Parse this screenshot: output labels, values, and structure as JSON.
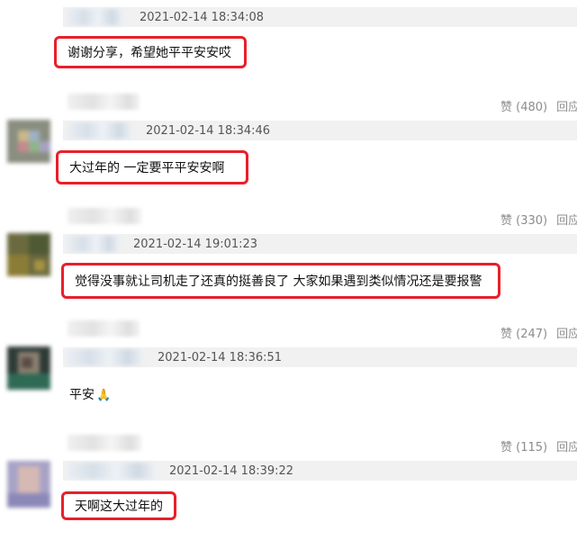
{
  "comments": [
    {
      "timestamp": "2021-02-14 18:34:08",
      "text": "谢谢分享，希望她平平安安哎",
      "highlighted": true
    },
    {
      "timestamp": "2021-02-14 18:34:46",
      "text": "大过年的 一定要平平安安啊",
      "highlighted": true,
      "likes": "赞 (480)",
      "reply": "回应"
    },
    {
      "timestamp": "2021-02-14 19:01:23",
      "text": "觉得没事就让司机走了还真的挺善良了 大家如果遇到类似情况还是要报警",
      "highlighted": true,
      "likes": "赞 (330)",
      "reply": "回应"
    },
    {
      "timestamp": "2021-02-14 18:36:51",
      "text": "平安",
      "emoji_icon": "pray-icon",
      "highlighted": false,
      "likes": "赞 (247)",
      "reply": "回应"
    },
    {
      "timestamp": "2021-02-14 18:39:22",
      "text": "天啊这大过年的",
      "highlighted": true,
      "likes": "赞 (115)",
      "reply": "回应"
    }
  ],
  "colors": {
    "highlight_border": "#e8202a",
    "meta_band": "#f1f1f1",
    "action_text": "#8c8c8c"
  }
}
